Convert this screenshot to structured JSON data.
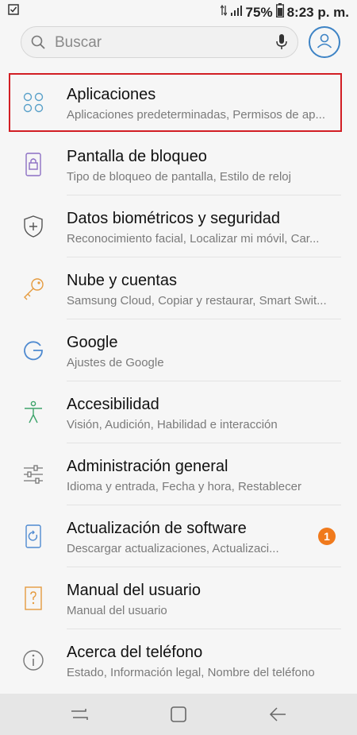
{
  "status": {
    "battery": "75%",
    "time": "8:23 p. m."
  },
  "search": {
    "placeholder": "Buscar"
  },
  "items": [
    {
      "title": "Aplicaciones",
      "subtitle": "Aplicaciones predeterminadas, Permisos de ap..."
    },
    {
      "title": "Pantalla de bloqueo",
      "subtitle": "Tipo de bloqueo de pantalla, Estilo de reloj"
    },
    {
      "title": "Datos biométricos y seguridad",
      "subtitle": "Reconocimiento facial, Localizar mi móvil, Car..."
    },
    {
      "title": "Nube y cuentas",
      "subtitle": "Samsung Cloud, Copiar y restaurar, Smart Swit..."
    },
    {
      "title": "Google",
      "subtitle": "Ajustes de Google"
    },
    {
      "title": "Accesibilidad",
      "subtitle": "Visión, Audición, Habilidad e interacción"
    },
    {
      "title": "Administración general",
      "subtitle": "Idioma y entrada, Fecha y hora, Restablecer"
    },
    {
      "title": "Actualización de software",
      "subtitle": "Descargar actualizaciones, Actualizaci...",
      "badge": "1"
    },
    {
      "title": "Manual del usuario",
      "subtitle": "Manual del usuario"
    },
    {
      "title": "Acerca del teléfono",
      "subtitle": "Estado, Información legal, Nombre del teléfono"
    }
  ],
  "icons": {
    "apps": "apps-icon",
    "lock": "lock-icon",
    "shield": "shield-icon",
    "key": "key-icon",
    "google": "google-icon",
    "accessibility": "accessibility-icon",
    "sliders": "sliders-icon",
    "update": "update-icon",
    "manual": "manual-icon",
    "info": "info-icon"
  },
  "colors": {
    "highlight": "#d21e24",
    "badge": "#f07a1c",
    "accent": "#3d83c5"
  }
}
